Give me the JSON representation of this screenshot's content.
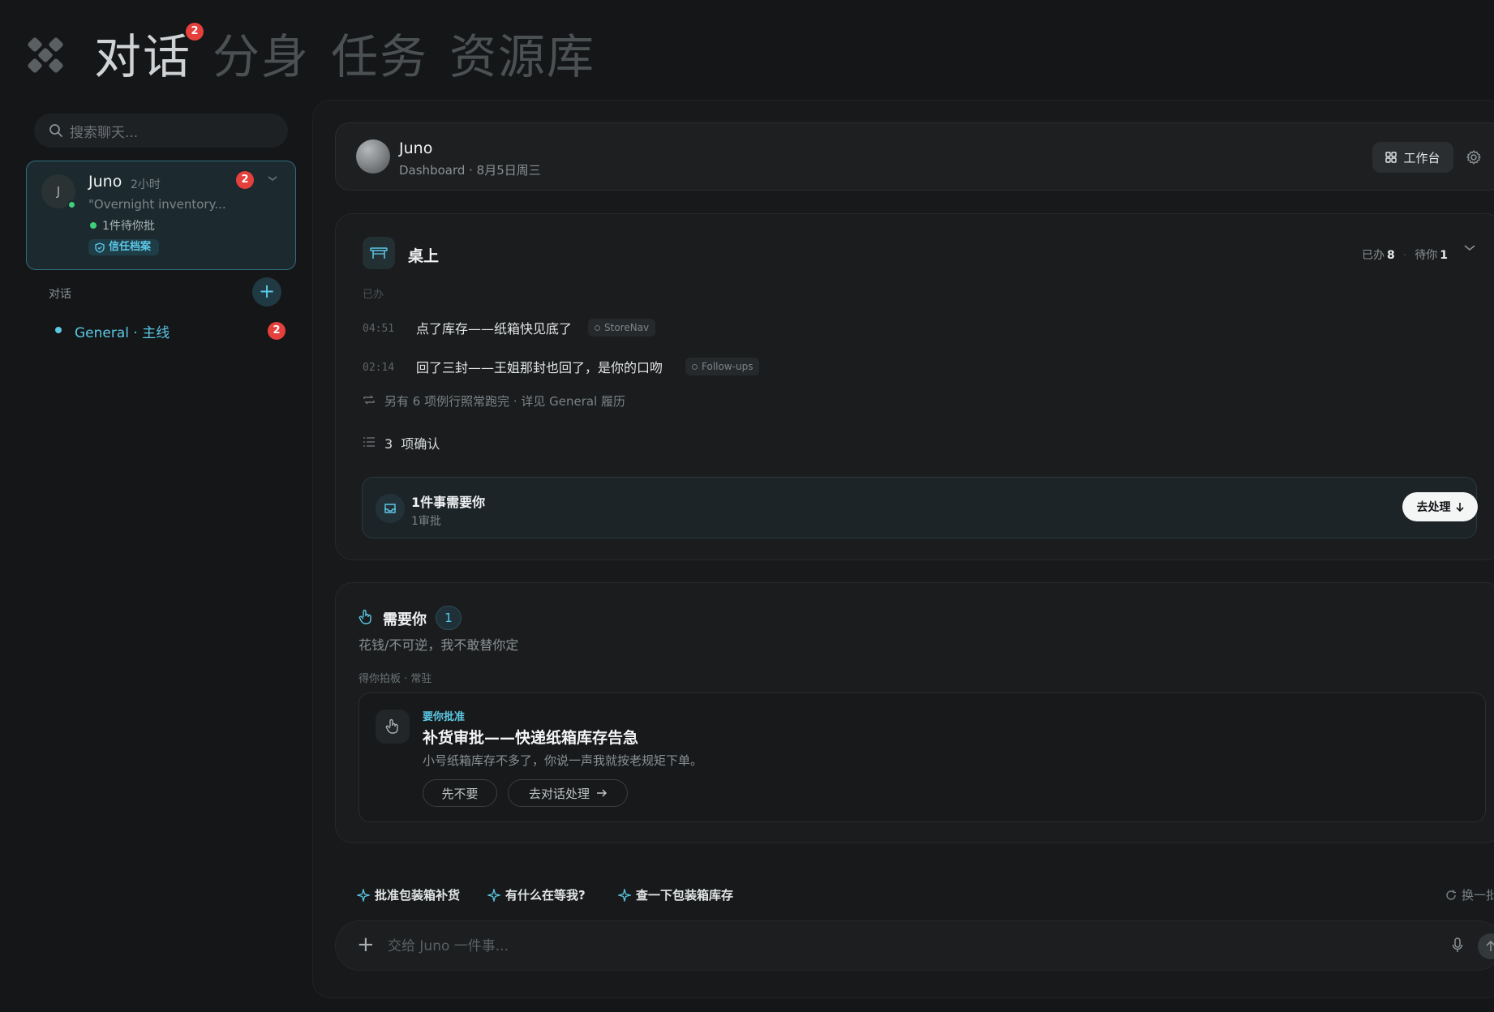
{
  "nav": {
    "tabs": [
      {
        "label": "对话",
        "active": true
      },
      {
        "label": "分身",
        "active": false
      },
      {
        "label": "任务",
        "active": false
      },
      {
        "label": "资源库",
        "active": false
      }
    ],
    "chat_badge": "2"
  },
  "sidebar": {
    "search_placeholder": "搜索聊天...",
    "agent": {
      "initial": "J",
      "name": "Juno",
      "time": "2小时",
      "quote": "\"Overnight inventory...",
      "pending": "1件待你批",
      "trust_badge": "信任档案",
      "badge": "2"
    },
    "section_label": "对话",
    "channels": [
      {
        "label": "General · 主线",
        "badge": "2"
      }
    ]
  },
  "header": {
    "name": "Juno",
    "subtitle": "Dashboard · 8月5日周三",
    "workbench_label": "工作台"
  },
  "desk": {
    "title": "桌上",
    "done_label": "已办",
    "done_count": "8",
    "waiting_label": "待你",
    "waiting_count": "1",
    "section_done": "已办",
    "logs": [
      {
        "time": "04:51",
        "text": "点了库存——纸箱快见底了",
        "chip": "StoreNav"
      },
      {
        "time": "02:14",
        "text": "回了三封——王姐那封也回了，是你的口吻",
        "chip": "Follow-ups"
      }
    ],
    "more": "另有 6 项例行照常跑完 · 详见 General 履历",
    "confirm_count": "3",
    "confirm_label": "项确认",
    "need": {
      "title": "1件事需要你",
      "sub": "1审批",
      "button": "去处理"
    }
  },
  "needs": {
    "title": "需要你",
    "count": "1",
    "subtitle": "花钱/不可逆，我不敢替你定",
    "group": "得你拍板 · 常驻",
    "approval": {
      "tag": "要你批准",
      "title": "补货审批——快递纸箱库存告急",
      "desc": "小号纸箱库存不多了，你说一声我就按老规矩下单。",
      "decline": "先不要",
      "handle": "去对话处理"
    }
  },
  "suggestions": [
    "批准包装箱补货",
    "有什么在等我?",
    "查一下包装箱库存"
  ],
  "refresh_label": "换一批",
  "composer": {
    "placeholder": "交给 Juno 一件事..."
  },
  "colors": {
    "accent": "#5cc8e6",
    "badge": "#e5403c",
    "online": "#3fcf7a",
    "background": "#141617"
  }
}
